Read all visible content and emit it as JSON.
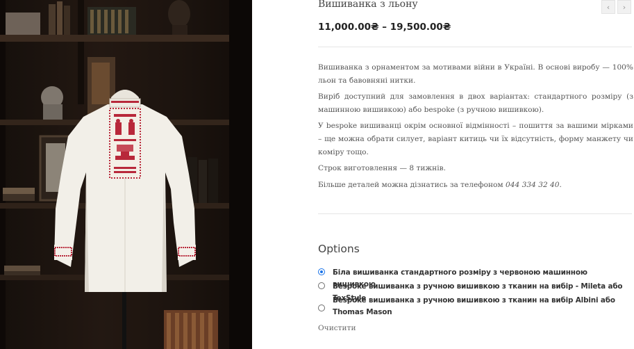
{
  "product": {
    "title": "Вишиванка з льону",
    "price": "11,000.00₴ – 19,500.00₴",
    "image_alt": "Вишиванка з льону на манекені"
  },
  "navigation": {
    "prev_icon": "‹",
    "next_icon": "›"
  },
  "description": {
    "p1": "Вишиванка з орнаментом за мотивами війни в Україні. В основі виробу — 100% льон та бавовняні нитки.",
    "p2": "Виріб доступний для замовлення в двох варіантах: стандартного розміру (з машинною вишивкою) або bespoke (з ручною вишивкою).",
    "p3": "У bespoke вишиванці окрім основної відмінності – пошиття за вашими мірками – ще можна обрати силует, варіант китиць чи їх відсутність, форму манжету чи коміру тощо.",
    "p4": "Строк виготовлення — 8 тижнів.",
    "p5_prefix": "Більше деталей можна дізнатись за телефоном",
    "phone": "044 334 32 40."
  },
  "options": {
    "heading": "Options",
    "items": [
      {
        "label": "Біла вишиванка стандартного розміру з червоною машинною вишивкою",
        "selected": true
      },
      {
        "label": "Bespoke вишиванка з ручною вишивкою з тканин на вибір - Mileta або TexStyle",
        "selected": false
      },
      {
        "label": "Bespoke вишиванка з ручною вишивкою з тканин на вибір Albini або Thomas Mason",
        "selected": false
      }
    ],
    "clear_label": "Очистити"
  },
  "colors": {
    "accent_radio": "#1a73e8",
    "embroidery_red": "#b8283a",
    "background_dark": "#1b130e"
  }
}
